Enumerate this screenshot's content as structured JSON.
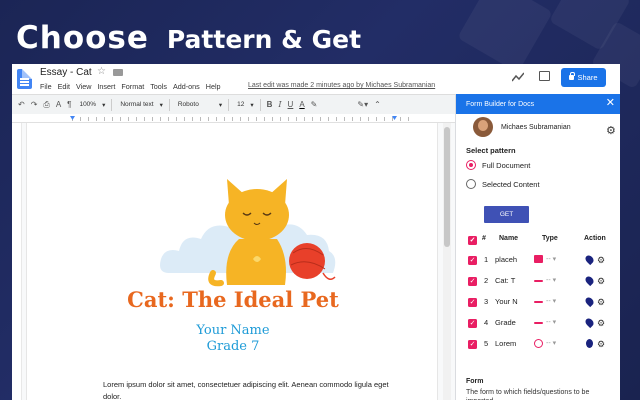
{
  "banner": {
    "title_a": "Choose",
    "title_b": "Pattern & Get"
  },
  "doc": {
    "title": "Essay - Cat",
    "menu": [
      "File",
      "Edit",
      "View",
      "Insert",
      "Format",
      "Tools",
      "Add-ons",
      "Help"
    ],
    "last_edit": "Last edit was made 2 minutes ago by Michaes Subramanian",
    "share_label": "Share",
    "toolbar": {
      "zoom": "100%",
      "style": "Normal text",
      "font": "Roboto",
      "size": "12"
    },
    "heading": "Cat: The Ideal Pet",
    "name": "Your Name",
    "grade": "Grade 7",
    "body": "Lorem ipsum dolor sit amet, consectetuer adipiscing elit. Aenean commodo ligula eget dolor."
  },
  "panel": {
    "title": "Form Builder for Docs",
    "close": "✕",
    "user": "Michaes Subramanian",
    "select_label": "Select pattern",
    "options": [
      {
        "label": "Full Document",
        "selected": true
      },
      {
        "label": "Selected Content",
        "selected": false
      }
    ],
    "get_label": "GET",
    "headers": {
      "num": "#",
      "name": "Name",
      "type": "Type",
      "action": "Action"
    },
    "rows": [
      {
        "num": "1",
        "name": "placeh",
        "type_color": "#e91e63"
      },
      {
        "num": "2",
        "name": "Cat: T",
        "type_color": "#e91e63"
      },
      {
        "num": "3",
        "name": "Your N",
        "type_color": "#e91e63"
      },
      {
        "num": "4",
        "name": "Grade",
        "type_color": "#e91e63"
      },
      {
        "num": "5",
        "name": "Lorem",
        "type_color": "#e91e63"
      }
    ],
    "form_label": "Form",
    "form_desc": "The form to which fields/questions to be imported"
  },
  "colors": {
    "accent": "#1a73e8",
    "pink": "#e91e63",
    "heading": "#e8681f",
    "name": "#1e9bd7",
    "get": "#3f51b5"
  }
}
